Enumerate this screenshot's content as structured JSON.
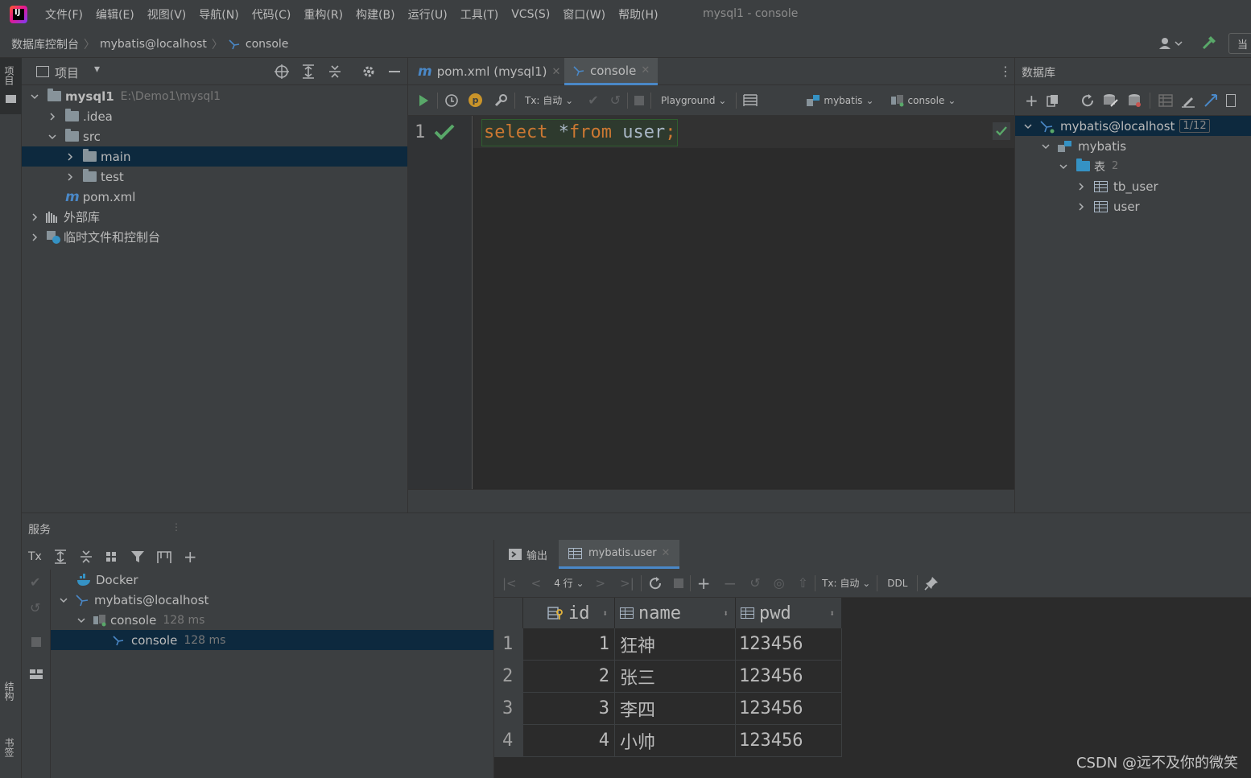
{
  "menubar": {
    "items": [
      "文件(F)",
      "编辑(E)",
      "视图(V)",
      "导航(N)",
      "代码(C)",
      "重构(R)",
      "构建(B)",
      "运行(U)",
      "工具(T)",
      "VCS(S)",
      "窗口(W)",
      "帮助(H)"
    ],
    "window_title": "mysql1 - console"
  },
  "breadcrumb": {
    "items": [
      "数据库控制台",
      "mybatis@localhost",
      "console"
    ],
    "right_partial": "当"
  },
  "left_strip": {
    "top_label": "项目",
    "structure_label": "结构",
    "bookmarks_label": "书签"
  },
  "project": {
    "title": "项目",
    "tree": [
      {
        "label": "mysql1",
        "path": "E:\\Demo1\\mysql1"
      },
      {
        "label": ".idea"
      },
      {
        "label": "src"
      },
      {
        "label": "main"
      },
      {
        "label": "test"
      },
      {
        "label": "pom.xml"
      },
      {
        "label": "外部库"
      },
      {
        "label": "临时文件和控制台"
      }
    ]
  },
  "editor": {
    "tabs": [
      {
        "label": "pom.xml (mysql1)"
      },
      {
        "label": "console"
      }
    ],
    "toolbar": {
      "tx": "Tx: 自动",
      "playground": "Playground",
      "schema": "mybatis",
      "session": "console"
    },
    "line_number": "1",
    "code": {
      "kw1": "select",
      "star": " *",
      "kw2": "from",
      "ident": " user",
      "semi": ";"
    }
  },
  "database": {
    "title": "数据库",
    "tree": [
      {
        "label": "mybatis@localhost",
        "badge": "1/12"
      },
      {
        "label": "mybatis"
      },
      {
        "label": "表",
        "count": "2"
      },
      {
        "label": "tb_user"
      },
      {
        "label": "user"
      }
    ]
  },
  "services": {
    "title": "服务",
    "tx_label": "Tx",
    "tree": [
      {
        "label": "Docker"
      },
      {
        "label": "mybatis@localhost"
      },
      {
        "label": "console",
        "time": "128 ms"
      },
      {
        "label": "console",
        "time": "128 ms"
      }
    ]
  },
  "results": {
    "tabs": [
      {
        "label": "输出"
      },
      {
        "label": "mybatis.user"
      }
    ],
    "toolbar": {
      "rows": "4 行",
      "tx": "Tx: 自动",
      "ddl": "DDL"
    },
    "columns": [
      "id",
      "name",
      "pwd"
    ],
    "rows": [
      {
        "num": "1",
        "id": "1",
        "name": "狂神",
        "pwd": "123456"
      },
      {
        "num": "2",
        "id": "2",
        "name": "张三",
        "pwd": "123456"
      },
      {
        "num": "3",
        "id": "3",
        "name": "李四",
        "pwd": "123456"
      },
      {
        "num": "4",
        "id": "4",
        "name": "小帅",
        "pwd": "123456"
      }
    ]
  },
  "watermark": "CSDN @远不及你的微笑"
}
